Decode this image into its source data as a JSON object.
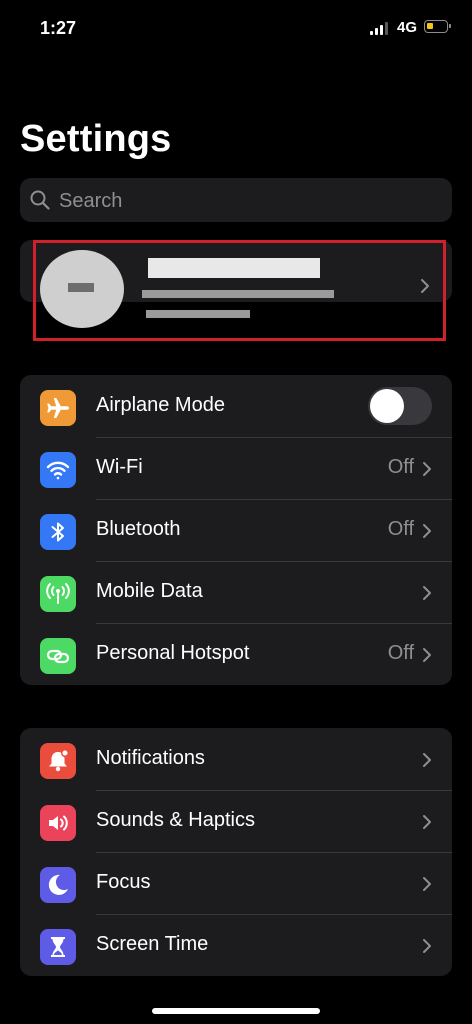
{
  "status_bar": {
    "time": "1:27",
    "network": "4G"
  },
  "page": {
    "title": "Settings"
  },
  "search": {
    "placeholder": "Search"
  },
  "profile": {
    "name": "",
    "subtitle": ""
  },
  "groups": [
    {
      "rows": [
        {
          "label": "Airplane Mode",
          "icon": "airplane-icon",
          "color": "#f09a37",
          "toggle": "off"
        },
        {
          "label": "Wi-Fi",
          "value": "Off",
          "icon": "wifi-icon",
          "color": "#3478f6"
        },
        {
          "label": "Bluetooth",
          "value": "Off",
          "icon": "bluetooth-icon",
          "color": "#3478f6"
        },
        {
          "label": "Mobile Data",
          "value": "",
          "icon": "antenna-icon",
          "color": "#4cd964"
        },
        {
          "label": "Personal Hotspot",
          "value": "Off",
          "icon": "hotspot-icon",
          "color": "#4cd964"
        }
      ]
    },
    {
      "rows": [
        {
          "label": "Notifications",
          "icon": "bell-icon",
          "color": "#eb4d3d"
        },
        {
          "label": "Sounds & Haptics",
          "icon": "speaker-icon",
          "color": "#eb445a"
        },
        {
          "label": "Focus",
          "icon": "moon-icon",
          "color": "#5e5ce6"
        },
        {
          "label": "Screen Time",
          "icon": "hourglass-icon",
          "color": "#5e5ce6"
        }
      ]
    }
  ],
  "colors": {
    "highlight": "#d1202b",
    "secondary_text": "#8e8e93"
  }
}
